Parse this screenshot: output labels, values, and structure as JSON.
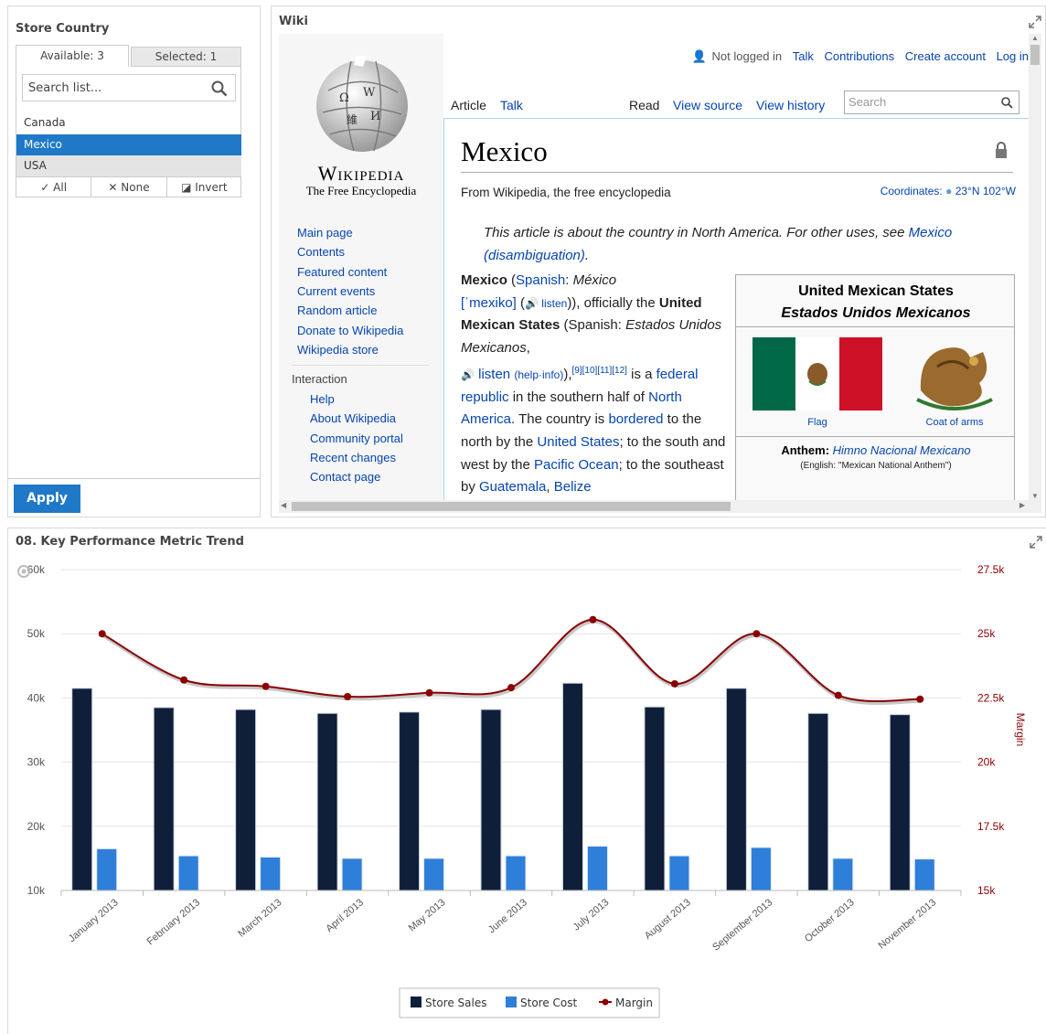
{
  "store_panel": {
    "title": "Store Country",
    "tab_available": "Available: 3",
    "tab_selected": "Selected: 1",
    "search_placeholder": "Search list...",
    "items": [
      "Canada",
      "Mexico",
      "USA"
    ],
    "selected_item": "Mexico",
    "actions": {
      "all": "All",
      "none": "None",
      "invert": "Invert"
    },
    "apply_label": "Apply"
  },
  "wiki_panel": {
    "title": "Wiki",
    "wordmark": "Wikipedia",
    "tagline": "The Free Encyclopedia",
    "nav": [
      "Main page",
      "Contents",
      "Featured content",
      "Current events",
      "Random article",
      "Donate to Wikipedia",
      "Wikipedia store"
    ],
    "interaction_heading": "Interaction",
    "interaction": [
      "Help",
      "About Wikipedia",
      "Community portal",
      "Recent changes",
      "Contact page"
    ],
    "user_links": {
      "status": "Not logged in",
      "talk": "Talk",
      "contributions": "Contributions",
      "create_account": "Create account",
      "login": "Log in"
    },
    "tabs": {
      "article": "Article",
      "talk": "Talk",
      "read": "Read",
      "view_source": "View source",
      "view_history": "View history"
    },
    "search_placeholder": "Search",
    "page_title": "Mexico",
    "from": "From Wikipedia, the free encyclopedia",
    "coordinates_label": "Coordinates:",
    "coordinates_value": "23°N 102°W",
    "hatnote_text": "This article is about the country in North America. For other uses, see",
    "hatnote_link": "Mexico (disambiguation)",
    "infobox": {
      "name": "United Mexican States",
      "native_name": "Estados Unidos Mexicanos",
      "flag_caption": "Flag",
      "coat_caption": "Coat of arms",
      "anthem_label": "Anthem:",
      "anthem_name": "Himno Nacional Mexicano",
      "anthem_english": "(English: \"Mexican National Anthem\")"
    },
    "colors": {
      "link": "#0645ad",
      "border_blue": "#a7d7f9"
    }
  },
  "chart_panel": {
    "title": "08. Key Performance Metric Trend"
  },
  "chart_data": {
    "type": "bar",
    "categories": [
      "January 2013",
      "February 2013",
      "March 2013",
      "April 2013",
      "May 2013",
      "June 2013",
      "July 2013",
      "August 2013",
      "September 2013",
      "October 2013",
      "November 2013"
    ],
    "series": [
      {
        "name": "Store Sales",
        "type": "bar",
        "axis": "left",
        "color": "#0f1f3a",
        "values": [
          41500,
          38500,
          38200,
          37600,
          37800,
          38200,
          42300,
          38600,
          41500,
          37600,
          37400
        ]
      },
      {
        "name": "Store Cost",
        "type": "bar",
        "axis": "left",
        "color": "#2e7fd9",
        "values": [
          16500,
          15400,
          15200,
          15000,
          15000,
          15400,
          16900,
          15400,
          16700,
          15000,
          14900
        ]
      },
      {
        "name": "Margin",
        "type": "line",
        "axis": "right",
        "color": "#8b0000",
        "values": [
          25000,
          23200,
          22950,
          22550,
          22700,
          22900,
          25550,
          23050,
          25000,
          22600,
          22450
        ]
      }
    ],
    "y_left": {
      "ticks": [
        "60k",
        "50k",
        "40k",
        "30k",
        "20k",
        "10k"
      ],
      "range": [
        10000,
        60000
      ]
    },
    "y_right": {
      "label": "Margin",
      "ticks": [
        "27.5k",
        "25k",
        "22.5k",
        "20k",
        "17.5k",
        "15k"
      ],
      "range": [
        15000,
        27500
      ]
    },
    "grid": "horizontal",
    "legend_position": "bottom-center"
  }
}
